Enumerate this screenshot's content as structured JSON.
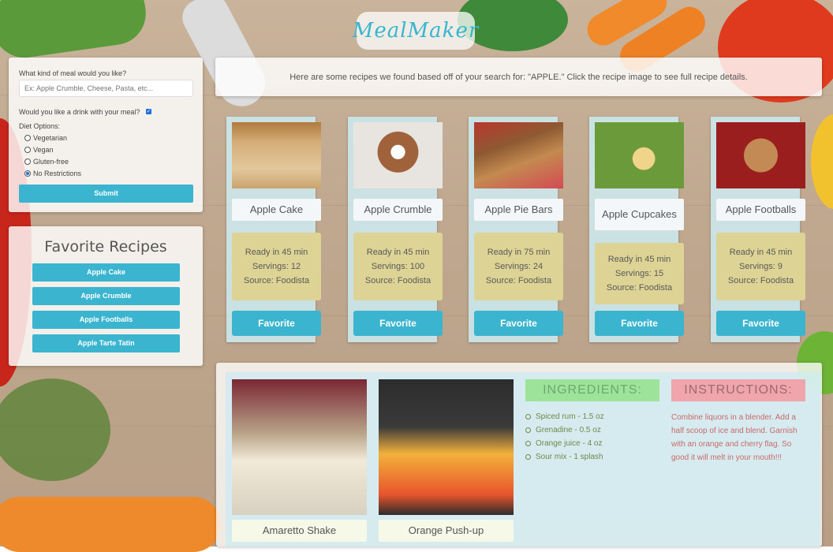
{
  "app": {
    "logo": "MealMaker"
  },
  "search": {
    "question": "What kind of meal would you like?",
    "placeholder": "Ex: Apple Crumble, Cheese, Pasta, etc...",
    "drink_label": "Would you like a drink with your meal?",
    "drink_checked": true,
    "diet_label": "Diet Options:",
    "diet_options": [
      "Vegetarian",
      "Vegan",
      "Gluten-free",
      "No Restrictions"
    ],
    "diet_selected": "No Restrictions",
    "submit_label": "Submit"
  },
  "favorites": {
    "title": "Favorite Recipes",
    "items": [
      "Apple Cake",
      "Apple Crumble",
      "Apple Footballs",
      "Apple Tarte Tatin"
    ]
  },
  "results_message": "Here are some recipes we found based off of your search for: \"APPLE.\" Click the recipe image to see full recipe details.",
  "recipes": [
    {
      "name": "Apple Cake",
      "ready": "Ready in 45 min",
      "servings": "Servings: 12",
      "source": "Source: Foodista",
      "button": "Favorite"
    },
    {
      "name": "Apple Crumble",
      "ready": "Ready in 45 min",
      "servings": "Servings: 100",
      "source": "Source: Foodista",
      "button": "Favorite"
    },
    {
      "name": "Apple Pie Bars",
      "ready": "Ready in 75 min",
      "servings": "Servings: 24",
      "source": "Source: Foodista",
      "button": "Favorite"
    },
    {
      "name": "Apple Cupcakes",
      "ready": "Ready in 45 min",
      "servings": "Servings: 15",
      "source": "Source: Foodista",
      "button": "Favorite"
    },
    {
      "name": "Apple Footballs",
      "ready": "Ready in 45 min",
      "servings": "Servings: 9",
      "source": "Source: Foodista",
      "button": "Favorite"
    }
  ],
  "drinks": [
    {
      "name": "Amaretto Shake"
    },
    {
      "name": "Orange Push-up"
    }
  ],
  "ingredients": {
    "title": "INGREDIENTS:",
    "items": [
      "Spiced rum - 1.5 oz",
      "Grenadine - 0.5 oz",
      "Orange juice - 4 oz",
      "Sour mix - 1 splash"
    ]
  },
  "instructions": {
    "title": "INSTRUCTIONS:",
    "text": "Combine liquors in a blender. Add a half scoop of ice and blend. Garnish with an orange and cherry flag. So good it will melt in your mouth!!!"
  },
  "colors": {
    "accent": "#3bb5cf",
    "info_bg": "#ddd394",
    "ingredients_bg": "#9ee39a",
    "instructions_bg": "#f0a5ad"
  }
}
